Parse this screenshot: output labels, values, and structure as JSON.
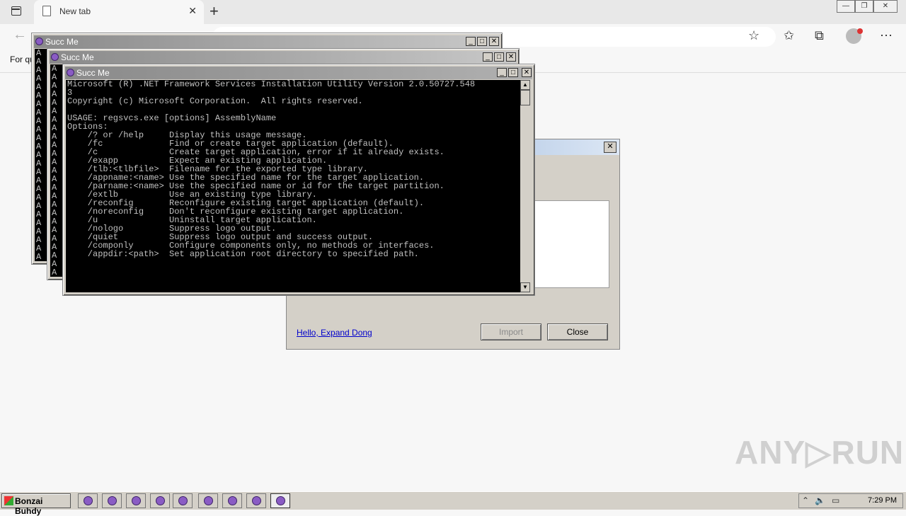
{
  "browser": {
    "tab_title": "New tab",
    "tab_close": "✕",
    "new_tab_glyph": "+",
    "back_glyph": "←",
    "favbar_text": "For qu",
    "window_controls": [
      "—",
      "❐",
      "✕"
    ],
    "toolbar_icons": [
      "add-favorite-icon",
      "favorites-icon",
      "collections-icon",
      "profile-avatar-icon",
      "more-icon"
    ],
    "toolbar_glyphs": [
      "☆",
      "✩",
      "⧉",
      "⋯"
    ]
  },
  "dialog": {
    "close_glyph": "✕",
    "link_text": "Hello, Expand Dong",
    "import_label": "Import",
    "close_label": "Close"
  },
  "consoles": [
    {
      "title": "Succ Me",
      "a_column": "A\nA\nA\nA\nA\nA\nA\nA\nA\nA\nA\nA\nA\nA\nA\nA\nA\nA\nA\nA\nA\nA\nA\nA\nA"
    },
    {
      "title": "Succ Me",
      "a_column": "A\nA\nA\nA\nA\nA\nA\nA\nA\nA\nA\nA\nA\nA\nA\nA\nA\nA\nA\nA\nA\nA\nA\nA\nA"
    },
    {
      "title": "Succ Me",
      "output": "Microsoft (R) .NET Framework Services Installation Utility Version 2.0.50727.548\n3\nCopyright (c) Microsoft Corporation.  All rights reserved.\n\nUSAGE: regsvcs.exe [options] AssemblyName\nOptions:\n    /? or /help     Display this usage message.\n    /fc             Find or create target application (default).\n    /c              Create target application, error if it already exists.\n    /exapp          Expect an existing application.\n    /tlb:<tlbfile>  Filename for the exported type library.\n    /appname:<name> Use the specified name for the target application.\n    /parname:<name> Use the specified name or id for the target partition.\n    /extlb          Use an existing type library.\n    /reconfig       Reconfigure existing target application (default).\n    /noreconfig     Don't reconfigure existing target application.\n    /u              Uninstall target application.\n    /nologo         Suppress logo output.\n    /quiet          Suppress logo output and success output.\n    /componly       Configure components only, no methods or interfaces.\n    /appdir:<path>  Set application root directory to specified path."
    }
  ],
  "console_buttons": {
    "minimize": "_",
    "maximize": "□",
    "close": "✕",
    "scroll_up": "▲",
    "scroll_down": "▼"
  },
  "watermark": "ANY▷RUN",
  "taskbar": {
    "start_label": "Bonzai Buhdy",
    "clock": "7:29 PM",
    "tray_glyphs": [
      "⌃",
      "🔈",
      "▭"
    ]
  }
}
